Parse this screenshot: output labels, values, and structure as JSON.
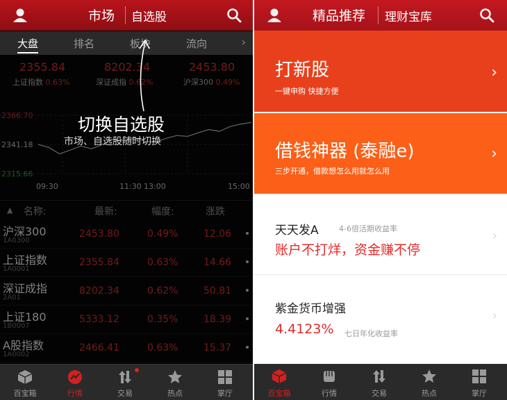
{
  "left": {
    "header": {
      "tab_market": "市场",
      "tab_watchlist": "自选股"
    },
    "sub_tabs": [
      "大盘",
      "排名",
      "板块",
      "流向"
    ],
    "indices": [
      {
        "value": "2355.84",
        "name": "上证指数",
        "change": "0.63%"
      },
      {
        "value": "8202.34",
        "name": "深证成指",
        "change": "0.62%"
      },
      {
        "value": "2453.80",
        "name": "沪深300",
        "change": "0.49%"
      }
    ],
    "chart_data": {
      "type": "line",
      "y_ticks": [
        "2366.70",
        "2341.18",
        "2315.66"
      ],
      "ylim": [
        2315.66,
        2366.7
      ],
      "x_ticks": [
        "09:30",
        "11:30",
        "13:00",
        "15:00"
      ],
      "series": [
        {
          "values": [
            2341.18,
            2338.5,
            2333.0,
            2336.2,
            2339.8,
            2337.4,
            2341.0,
            2345.6,
            2344.2,
            2346.8,
            2344.0,
            2343.1,
            2346.5,
            2349.0,
            2348.2,
            2351.4,
            2354.2,
            2352.6,
            2356.8,
            2358.9,
            2360.5
          ]
        }
      ],
      "grid": true
    },
    "overlay": {
      "title": "切换自选股",
      "subtitle": "市场、自选股随时切换"
    },
    "table": {
      "headers": [
        "名称:",
        "最新:",
        "幅度:",
        "涨跌"
      ],
      "rows": [
        {
          "name": "沪深300",
          "code": "1A0300",
          "latest": "2453.80",
          "pct": "0.49%",
          "chg": "12.06"
        },
        {
          "name": "上证指数",
          "code": "1A0001",
          "latest": "2355.84",
          "pct": "0.63%",
          "chg": "14.66"
        },
        {
          "name": "深证成指",
          "code": "2A01",
          "latest": "8202.34",
          "pct": "0.62%",
          "chg": "50.81"
        },
        {
          "name": "上证180",
          "code": "1B0007",
          "latest": "5333.12",
          "pct": "0.35%",
          "chg": "18.39"
        },
        {
          "name": "A股指数",
          "code": "1A0002",
          "latest": "2466.41",
          "pct": "0.63%",
          "chg": "15.37"
        }
      ]
    },
    "bottom_nav": [
      "百宝箱",
      "行情",
      "交易",
      "热点",
      "掌厅"
    ]
  },
  "right": {
    "header": {
      "title": "精品推荐",
      "tab2": "理财宝库"
    },
    "banners": [
      {
        "title": "打新股",
        "subtitle": "一键申购 快捷方便",
        "color": "#e8401c"
      },
      {
        "title": "借钱神器 (泰融e)",
        "subtitle": "三步开通，借款想怎么用就怎么用",
        "color": "#fb5f18"
      }
    ],
    "funds": [
      {
        "name": "天天发A",
        "desc": "4-6倍活期收益率",
        "highlight": "账户不打烊，资金赚不停"
      },
      {
        "name": "紫金货币增强",
        "desc": "七日年化收益率",
        "highlight": "4.4123%"
      }
    ],
    "bottom_nav": [
      "百宝箱",
      "行情",
      "交易",
      "热点",
      "掌厅"
    ]
  },
  "colors": {
    "brand_red": "#b8141b",
    "up_red": "#e13434",
    "text_red": "#e12a2a"
  }
}
